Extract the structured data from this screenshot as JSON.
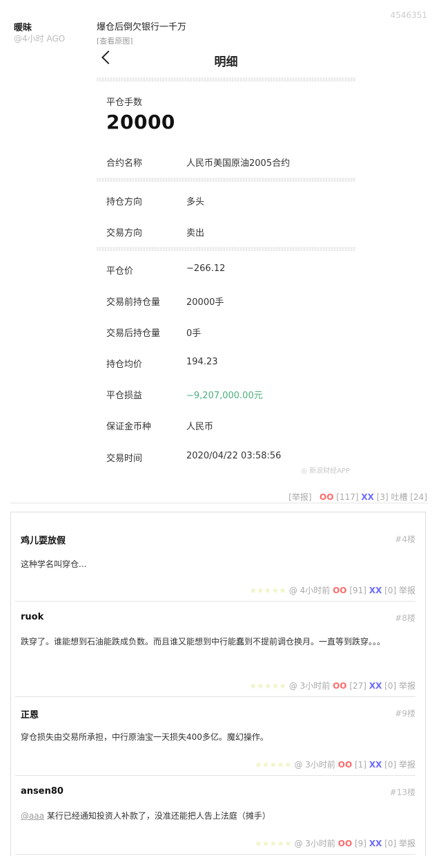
{
  "post": {
    "user": "暖昧",
    "ago": "@4小时 AGO",
    "id": "4546351",
    "title": "爆仓后倒欠银行一千万",
    "view_original": "[查看原图]",
    "footer": {
      "report": "[举报]",
      "oo_label": "OO",
      "oo_count": "[117]",
      "xx_label": "XX",
      "xx_count": "[3]",
      "tucao": "吐槽 [24]"
    }
  },
  "screenshot": {
    "header_title": "明细",
    "close_lots_label": "平仓手数",
    "close_lots_value": "20000",
    "rows": [
      {
        "label": "合约名称",
        "value": "人民币美国原油2005合约"
      },
      {
        "label": "持仓方向",
        "value": "多头"
      },
      {
        "label": "交易方向",
        "value": "卖出"
      },
      {
        "label": "平仓价",
        "value": "−266.12"
      },
      {
        "label": "交易前持仓量",
        "value": "20000手"
      },
      {
        "label": "交易后持仓量",
        "value": "0手"
      },
      {
        "label": "持仓均价",
        "value": "194.23"
      },
      {
        "label": "平仓损益",
        "value": "−9,207,000.00元"
      },
      {
        "label": "保证金币种",
        "value": "人民币"
      },
      {
        "label": "交易时间",
        "value": "2020/04/22 03:58:56"
      }
    ],
    "watermark": "新浪财经APP"
  },
  "comments": [
    {
      "user": "鸡儿耍放假",
      "floor": "#4楼",
      "text": "这种学名叫穿仓...",
      "mention": "",
      "time": "4小时前",
      "oo": "[91]",
      "xx": "[0]"
    },
    {
      "user": "ruok",
      "floor": "#8楼",
      "text": "跌穿了。谁能想到石油能跌成负数。而且谁又能想到中行能蠢到不提前调仓换月。一直等到跌穿。。。",
      "mention": "",
      "time": "3小时前",
      "oo": "[27]",
      "xx": "[0]"
    },
    {
      "user": "正恩",
      "floor": "#9楼",
      "text": "穿仓损失由交易所承担，中行原油宝一天损失400多亿。魔幻操作。",
      "mention": "",
      "time": "3小时前",
      "oo": "[1]",
      "xx": "[0]"
    },
    {
      "user": "ansen80",
      "floor": "#13楼",
      "text": " 某行已经通知投资人补款了，没准还能把人告上法庭（摊手）",
      "mention": "@aaa",
      "time": "3小时前",
      "oo": "[9]",
      "xx": "[0]"
    }
  ],
  "comment_labels": {
    "at": "@",
    "oo": "OO",
    "xx": "XX",
    "report": "举报"
  },
  "colors": {
    "loss_green": "#4caf7d",
    "oo_red": "#ff6a6a",
    "xx_blue": "#6b6bff"
  }
}
